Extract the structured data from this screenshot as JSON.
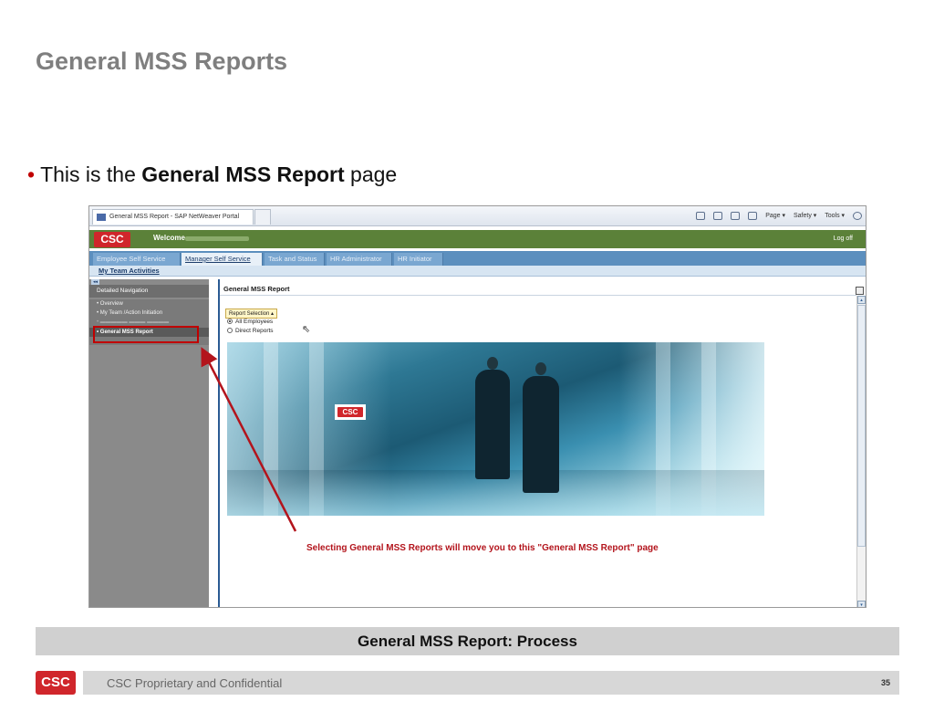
{
  "slide": {
    "title": "General MSS Reports",
    "bullet_prefix": "This is the ",
    "bullet_bold": "General MSS Report",
    "bullet_suffix": " page",
    "process_caption": "General MSS Report: Process",
    "footer_text": "CSC Proprietary and Confidential",
    "page_number": "35",
    "logo_text": "CSC"
  },
  "browser": {
    "tab_title": "General MSS Report - SAP NetWeaver Portal",
    "toolbar": [
      "Page ▾",
      "Safety ▾",
      "Tools ▾"
    ]
  },
  "portal": {
    "logo": "CSC",
    "welcome": "Welcome",
    "logoff": "Log off",
    "tabs": [
      "Employee Self Service",
      "Manager Self Service",
      "Task and Status",
      "HR Administrator",
      "HR Initiator"
    ],
    "active_tab": "Manager Self Service",
    "subtab": "My Team Activities",
    "nav_header": "Detailed Navigation",
    "nav_items": [
      "Overview",
      "My Team /Action Initiation",
      "General MSS Report"
    ],
    "content_title": "General MSS Report",
    "report_selection": "Report Selection ▴",
    "radio_all": "All Employees",
    "radio_direct": "Direct Reports",
    "photo_logo": "CSC",
    "callout": "Selecting General MSS Reports will move you to this \"General MSS Report\" page"
  },
  "colors": {
    "brand_red": "#d0262b",
    "portal_green": "#5b8139",
    "tab_blue": "#5c8fbe",
    "highlight_red": "#c00000"
  }
}
